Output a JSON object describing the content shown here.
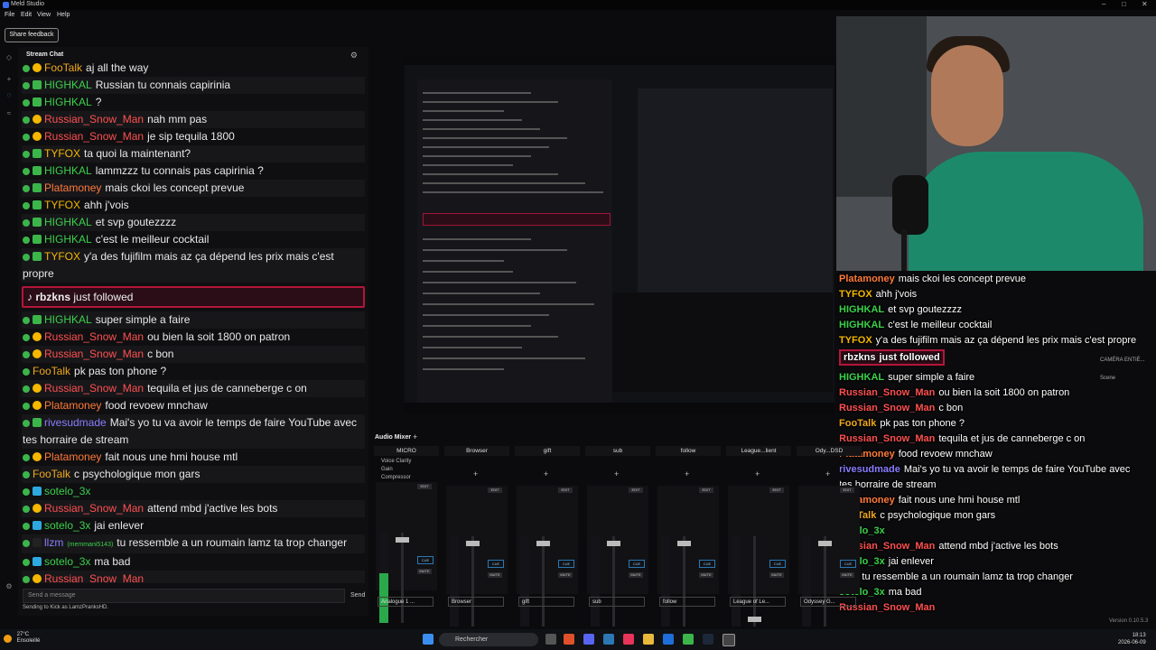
{
  "window": {
    "title": "Meld Studio",
    "minimize": "–",
    "maximize": "□",
    "close": "✕"
  },
  "menu": [
    "File",
    "Edit",
    "View",
    "Help"
  ],
  "share_feedback": "Share feedback",
  "chat": {
    "title": "Stream Chat",
    "messages": [
      {
        "user": "FooTalk",
        "color": "#f0a81c",
        "text": "aj all the way",
        "badge": "warn"
      },
      {
        "user": "HIGHKAL",
        "color": "#3bd14a",
        "text": "Russian tu connais capirinia",
        "badge": "green"
      },
      {
        "user": "HIGHKAL",
        "color": "#3bd14a",
        "text": "?",
        "badge": "green"
      },
      {
        "user": "Russian_Snow_Man",
        "color": "#ff5050",
        "text": "nah mm pas",
        "badge": "warn"
      },
      {
        "user": "Russian_Snow_Man",
        "color": "#ff5050",
        "text": "je sip tequila 1800",
        "badge": "warn"
      },
      {
        "user": "TYFOX",
        "color": "#f5b700",
        "text": "ta quoi la maintenant?",
        "badge": "green"
      },
      {
        "user": "HIGHKAL",
        "color": "#3bd14a",
        "text": "lammzzz tu connais pas capirinia ?",
        "badge": "green"
      },
      {
        "user": "Platamoney",
        "color": "#ff7a3a",
        "text": "mais ckoi les concept prevue",
        "badge": "green"
      },
      {
        "user": "TYFOX",
        "color": "#f5b700",
        "text": "ahh j'vois",
        "badge": "green"
      },
      {
        "user": "HIGHKAL",
        "color": "#3bd14a",
        "text": "et svp goutezzzz",
        "badge": "green"
      },
      {
        "user": "HIGHKAL",
        "color": "#3bd14a",
        "text": "c'est le meilleur cocktail",
        "badge": "green"
      },
      {
        "user": "TYFOX",
        "color": "#f5b700",
        "text": "y'a des fujifilm mais az ça dépend les prix mais c'est propre",
        "badge": "green"
      }
    ],
    "follow": {
      "user": "rbzkns",
      "text": "just followed"
    },
    "messages2": [
      {
        "user": "HIGHKAL",
        "color": "#3bd14a",
        "text": "super simple a faire",
        "badge": "green"
      },
      {
        "user": "Russian_Snow_Man",
        "color": "#ff5050",
        "text": "ou bien la soit 1800 on patron",
        "badge": "warn"
      },
      {
        "user": "Russian_Snow_Man",
        "color": "#ff5050",
        "text": "c bon",
        "badge": "warn"
      },
      {
        "user": "FooTalk",
        "color": "#f0a81c",
        "text": "pk pas ton phone ?",
        "badge": ""
      },
      {
        "user": "Russian_Snow_Man",
        "color": "#ff5050",
        "text": "tequila et jus de canneberge c on",
        "badge": "warn"
      },
      {
        "user": "Platamoney",
        "color": "#ff7a3a",
        "text": "food revoew mnchaw",
        "badge": "warn"
      },
      {
        "user": "rivesudmade",
        "color": "#8a7dff",
        "text": "Mai's yo tu va avoir le temps de faire YouTube avec tes horraire de stream",
        "badge": "green"
      },
      {
        "user": "Platamoney",
        "color": "#ff7a3a",
        "text": "fait nous une hmi house mtl",
        "badge": "warn"
      },
      {
        "user": "FooTalk",
        "color": "#f0a81c",
        "text": "c psychologique mon gars",
        "badge": ""
      },
      {
        "user": "sotelo_3x",
        "color": "#3bd14a",
        "text": "",
        "badge": "blue"
      },
      {
        "user": "Russian_Snow_Man",
        "color": "#ff5050",
        "text": "attend mbd j'active les bots",
        "badge": "warn"
      },
      {
        "user": "sotelo_3x",
        "color": "#3bd14a",
        "text": "jai enlever",
        "badge": "blue"
      },
      {
        "user": "llzm",
        "color": "#8a7dff",
        "text": "tu ressemble a un roumain lamz ta trop changer",
        "badge": "tiktok",
        "sub": "(memmani5143)"
      },
      {
        "user": "sotelo_3x",
        "color": "#3bd14a",
        "text": "ma bad",
        "badge": "blue"
      },
      {
        "user": "Russian_Snow_Man",
        "color": "#ff5050",
        "text": "",
        "badge": "warn"
      }
    ],
    "input_placeholder": "Send a message",
    "send_label": "Send",
    "sending_as": "Sending to Kick as LamzPranksHD."
  },
  "overlay_chat": [
    {
      "user": "Platamoney",
      "color": "#ff7a3a",
      "text": "mais ckoi les concept prevue"
    },
    {
      "user": "TYFOX",
      "color": "#f5b700",
      "text": "ahh j'vois"
    },
    {
      "user": "HIGHKAL",
      "color": "#3bd14a",
      "text": "et svp goutezzzz"
    },
    {
      "user": "HIGHKAL",
      "color": "#3bd14a",
      "text": "c'est le meilleur cocktail"
    },
    {
      "user": "TYFOX",
      "color": "#f5b700",
      "text": "y'a des fujifilm mais az ça dépend les prix mais c'est propre"
    },
    {
      "user": "rbzkns",
      "color": "#ffffff",
      "text": "just followed",
      "follow": true
    },
    {
      "user": "HIGHKAL",
      "color": "#3bd14a",
      "text": "super simple a faire"
    },
    {
      "user": "Russian_Snow_Man",
      "color": "#ff5050",
      "text": "ou bien la soit 1800 on patron"
    },
    {
      "user": "Russian_Snow_Man",
      "color": "#ff5050",
      "text": "c bon"
    },
    {
      "user": "FooTalk",
      "color": "#f0a81c",
      "text": "pk pas ton phone ?"
    },
    {
      "user": "Russian_Snow_Man",
      "color": "#ff5050",
      "text": "tequila et jus de canneberge c on"
    },
    {
      "user": "Platamoney",
      "color": "#ff7a3a",
      "text": "food revoew mnchaw"
    },
    {
      "user": "rivesudmade",
      "color": "#8a7dff",
      "text": "Mai's yo tu va avoir le temps de faire YouTube avec"
    },
    {
      "user": "",
      "color": "#ffffff",
      "text": "tes horraire de stream"
    },
    {
      "user": "Platamoney",
      "color": "#ff7a3a",
      "text": "fait nous une hmi house mtl"
    },
    {
      "user": "FooTalk",
      "color": "#f0a81c",
      "text": "c psychologique mon gars"
    },
    {
      "user": "sotelo_3x",
      "color": "#3bd14a",
      "text": ""
    },
    {
      "user": "Russian_Snow_Man",
      "color": "#ff5050",
      "text": "attend mbd j'active les bots"
    },
    {
      "user": "sotelo_3x",
      "color": "#3bd14a",
      "text": "jai enlever"
    },
    {
      "user": "llzm",
      "color": "#f5b700",
      "text": "tu ressemble a un roumain lamz ta trop changer"
    },
    {
      "user": "sotelo_3x",
      "color": "#3bd14a",
      "text": "ma bad"
    },
    {
      "user": "Russian_Snow_Man",
      "color": "#ff5050",
      "text": ""
    }
  ],
  "scene_panel": {
    "camera": "CAMÉRA ENTIÈ...",
    "scene": "Scene"
  },
  "mixer": {
    "title": "Audio Mixer",
    "add": "+",
    "channels": [
      {
        "name": "MICRO",
        "source": "Analogue 1 ...",
        "level": 0.55,
        "fader": 0.95,
        "fx": [
          "Voice Clarity",
          "Gain",
          "Compressor"
        ]
      },
      {
        "name": "Browser",
        "source": "Browser",
        "level": 0,
        "fader": 0.95
      },
      {
        "name": "gift",
        "source": "gift",
        "level": 0,
        "fader": 0.95
      },
      {
        "name": "sub",
        "source": "sub",
        "level": 0,
        "fader": 0.95
      },
      {
        "name": "follow",
        "source": "follow",
        "level": 0,
        "fader": 0.95
      },
      {
        "name": "League...lient",
        "source": "League of Le...",
        "level": 0,
        "fader": 0.05
      },
      {
        "name": "Ody...DSD",
        "source": "Odyssey G...",
        "level": 0,
        "fader": 0.95
      }
    ],
    "edit": "EDIT",
    "cue": "CUE",
    "mute": "MUTE"
  },
  "taskbar": {
    "temp": "27°C",
    "weather": "Ensoleillé",
    "search": "Rechercher",
    "time": "18:13",
    "date": "2026-06-09"
  },
  "version": "Version 0.10.5.3"
}
